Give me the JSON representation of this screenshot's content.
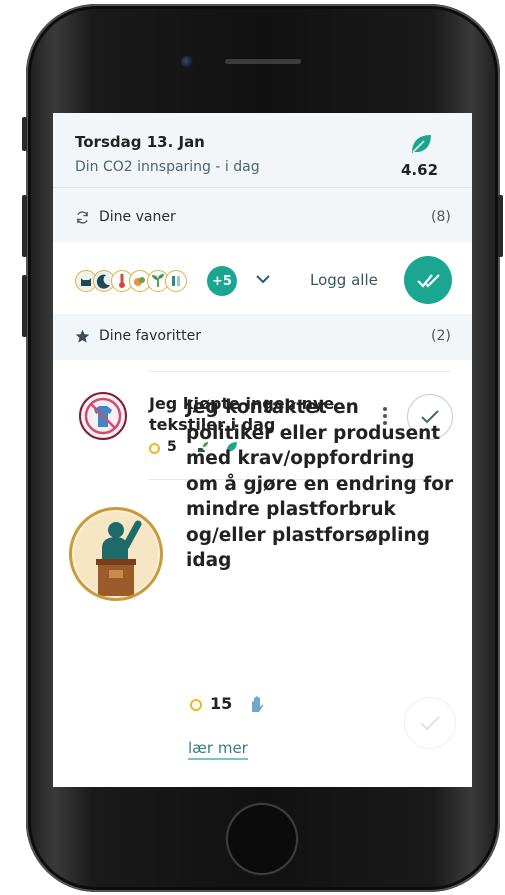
{
  "header": {
    "date": "Torsdag 13. Jan",
    "co2_label": "Din CO2 innsparing - i dag",
    "co2_value": "4.62"
  },
  "habits_section": {
    "title": "Dine vaner",
    "count": "(8)",
    "more_count": "+5",
    "log_all_label": "Logg alle"
  },
  "favorites_section": {
    "title": "Dine favoritter",
    "count": "(2)"
  },
  "favorites": [
    {
      "title": "Jeg kjøpte ingen nye tekstiler i dag",
      "title_line1": "Jeg kjøpte ingen nye",
      "title_line2": "tekstiler i dag",
      "points": "5"
    },
    {
      "title_lines": [
        "Jeg kontaktet en",
        "politiker eller produsent",
        "med krav/oppfordring",
        "om å gjøre en endring for",
        "mindre plastforbruk",
        "og/eller plastforsøpling",
        "idag"
      ],
      "points": "15",
      "link_label": "lær mer"
    }
  ],
  "colors": {
    "accent": "#1aa690",
    "coin": "#f0b429",
    "header_bg": "#f3f6f8"
  }
}
